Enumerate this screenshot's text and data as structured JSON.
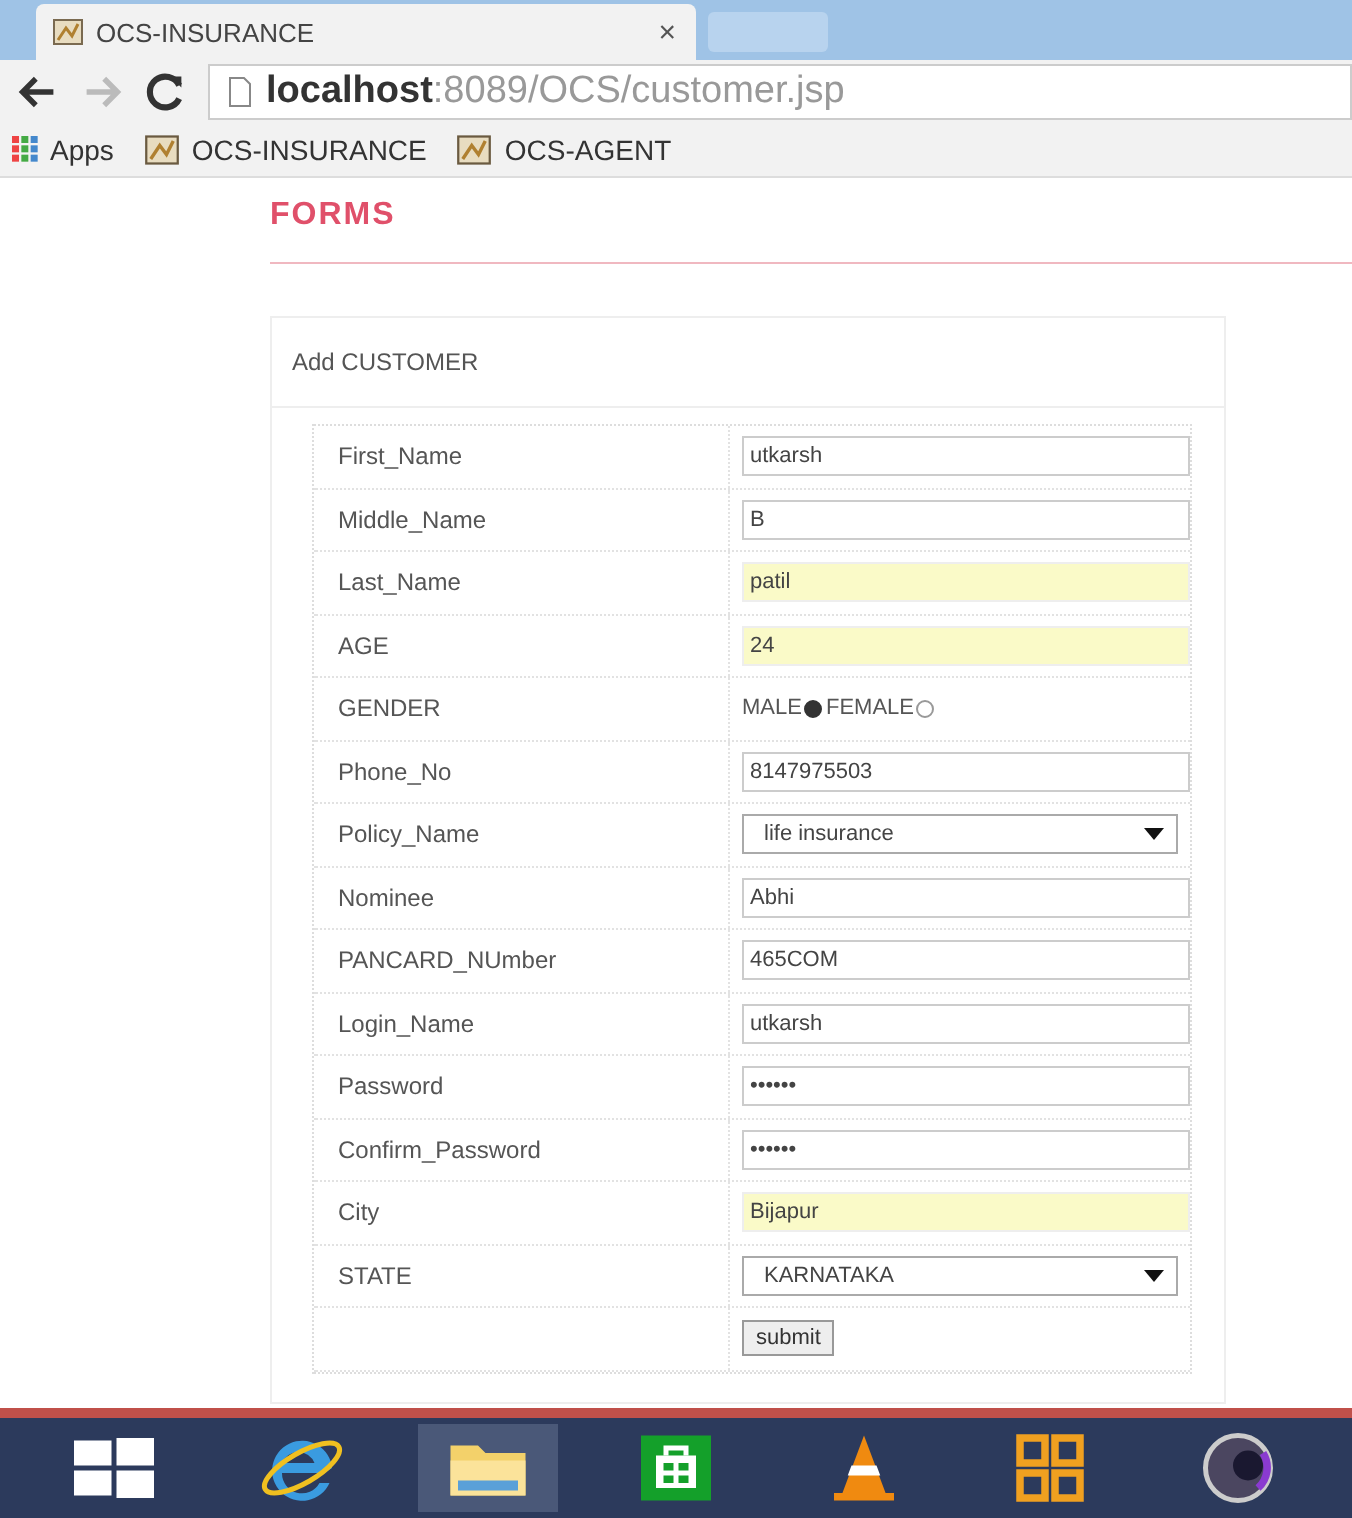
{
  "browser": {
    "tab": {
      "title": "OCS-INSURANCE",
      "close": "×"
    },
    "address": {
      "host": "localhost",
      "path": ":8089/OCS/customer.jsp"
    },
    "bookmarks": [
      {
        "label": "Apps",
        "kind": "apps"
      },
      {
        "label": "OCS-INSURANCE",
        "kind": "page"
      },
      {
        "label": "OCS-AGENT",
        "kind": "page"
      }
    ]
  },
  "page": {
    "heading": "FORMS",
    "form_title": "Add CUSTOMER",
    "fields": [
      {
        "label": "First_Name",
        "kind": "text",
        "value": "utkarsh",
        "autofilled": false
      },
      {
        "label": "Middle_Name",
        "kind": "text",
        "value": "B",
        "autofilled": false
      },
      {
        "label": "Last_Name",
        "kind": "text",
        "value": "patil",
        "autofilled": true
      },
      {
        "label": "AGE",
        "kind": "text",
        "value": "24",
        "autofilled": true
      },
      {
        "label": "GENDER",
        "kind": "radio",
        "options": [
          {
            "label": "MALE",
            "selected": true
          },
          {
            "label": "FEMALE",
            "selected": false
          }
        ]
      },
      {
        "label": "Phone_No",
        "kind": "text",
        "value": "8147975503",
        "autofilled": false
      },
      {
        "label": "Policy_Name",
        "kind": "select",
        "value": "life insurance"
      },
      {
        "label": "Nominee",
        "kind": "text",
        "value": "Abhi",
        "autofilled": false
      },
      {
        "label": "PANCARD_NUmber",
        "kind": "text",
        "value": "465COM",
        "autofilled": false
      },
      {
        "label": "Login_Name",
        "kind": "text",
        "value": "utkarsh",
        "autofilled": false
      },
      {
        "label": "Password",
        "kind": "text",
        "value": "••••••",
        "autofilled": false
      },
      {
        "label": "Confirm_Password",
        "kind": "text",
        "value": "••••••",
        "autofilled": false
      },
      {
        "label": "City",
        "kind": "text",
        "value": "Bijapur",
        "autofilled": true
      },
      {
        "label": "STATE",
        "kind": "select",
        "value": "KARNATAKA"
      }
    ],
    "submit": "submit"
  },
  "taskbar": [
    {
      "kind": "start",
      "active": false
    },
    {
      "kind": "ie",
      "active": false
    },
    {
      "kind": "folder",
      "active": true
    },
    {
      "kind": "store",
      "active": false
    },
    {
      "kind": "cone",
      "active": false
    },
    {
      "kind": "office",
      "active": false
    },
    {
      "kind": "orb",
      "active": false
    }
  ]
}
